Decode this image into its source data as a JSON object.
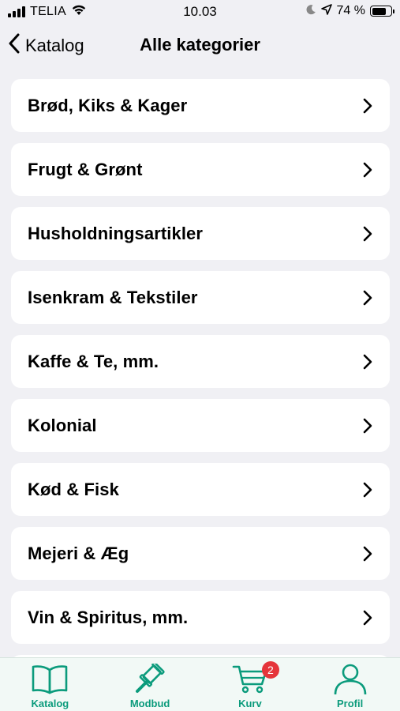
{
  "status_bar": {
    "carrier": "TELIA",
    "time": "10.03",
    "battery_percent": "74 %",
    "battery_level": 0.74,
    "icons": [
      "signal-icon",
      "wifi-icon",
      "moon-icon",
      "location-arrow-icon",
      "battery-icon"
    ]
  },
  "nav": {
    "back_label": "Katalog",
    "title": "Alle kategorier",
    "back_icon": "chevron-left-icon"
  },
  "categories": [
    {
      "label": "Brød, Kiks & Kager"
    },
    {
      "label": "Frugt & Grønt"
    },
    {
      "label": "Husholdningsartikler"
    },
    {
      "label": "Isenkram & Tekstiler"
    },
    {
      "label": "Kaffe & Te, mm."
    },
    {
      "label": "Kolonial"
    },
    {
      "label": "Kød & Fisk"
    },
    {
      "label": "Mejeri & Æg"
    },
    {
      "label": "Vin & Spiritus, mm."
    }
  ],
  "tab_bar": {
    "accent_color": "#0b9b7c",
    "badge_color": "#e5353b",
    "tabs": [
      {
        "label": "Katalog",
        "icon": "book-icon"
      },
      {
        "label": "Modbud",
        "icon": "gavel-icon"
      },
      {
        "label": "Kurv",
        "icon": "cart-icon",
        "badge": "2"
      },
      {
        "label": "Profil",
        "icon": "user-icon"
      }
    ]
  }
}
